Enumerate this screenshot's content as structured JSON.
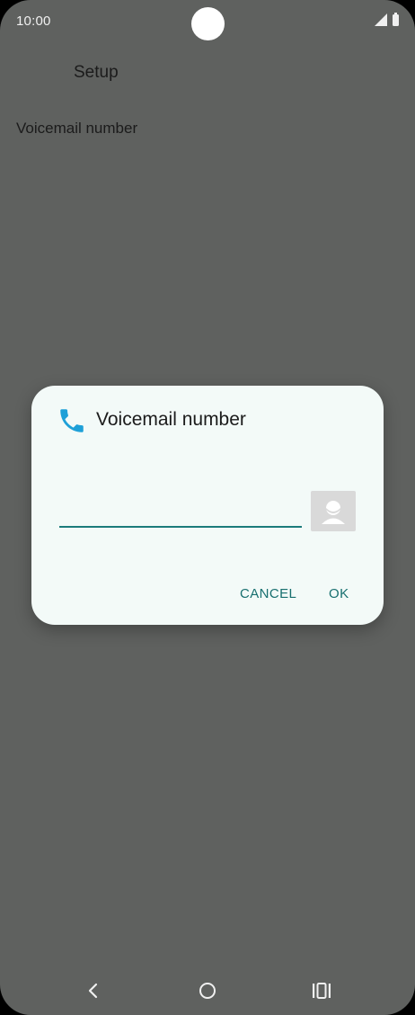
{
  "status_bar": {
    "time": "10:00"
  },
  "app_bar": {
    "title": "Setup"
  },
  "preference": {
    "label": "Voicemail number"
  },
  "dialog": {
    "title": "Voicemail number",
    "input": {
      "value": "",
      "placeholder": ""
    },
    "cancel_label": "CANCEL",
    "ok_label": "OK",
    "icon": "phone-icon",
    "accent_color": "#1ea0d8",
    "underline_color": "#1b7b7b"
  },
  "navigation": {
    "back_icon": "back-icon",
    "home_icon": "home-icon",
    "recents_icon": "recents-icon"
  }
}
